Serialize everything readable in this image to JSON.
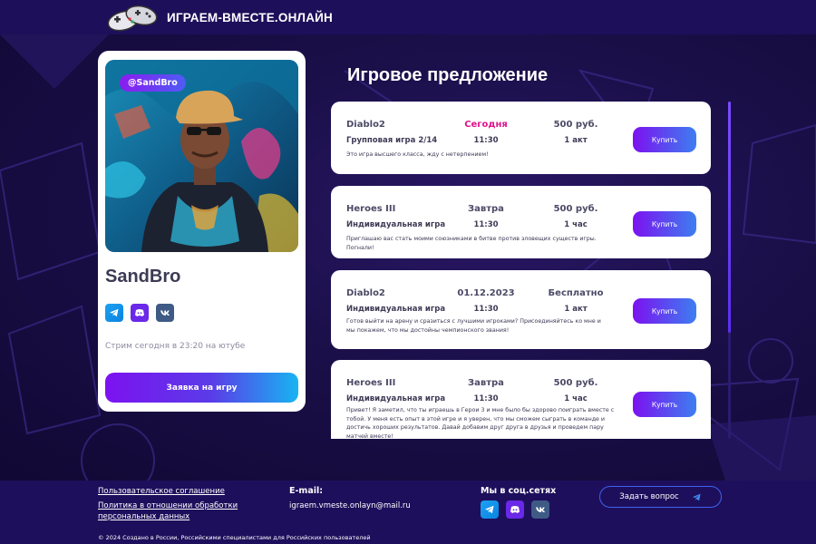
{
  "site": {
    "title": "ИГРАЕМ-ВМЕСТЕ.ОНЛАЙН",
    "logo_icon": "gamepads-icon"
  },
  "profile": {
    "handle": "@SandBro",
    "name": "SandBro",
    "socials": [
      "telegram-icon",
      "discord-icon",
      "vk-icon"
    ],
    "stream_text": "Стрим сегодня в 23:20 на ютубе",
    "apply_label": "Заявка на игру"
  },
  "offers_title": "Игровое предложение",
  "offers": [
    {
      "game": "Diablo2",
      "date": "Сегодня",
      "price": "500 руб.",
      "type": "Групповая игра 2/14",
      "time": "11:30",
      "duration": "1 акт",
      "desc": "Это игра высшего класса, жду с нетерпением!",
      "buy_label": "Купить"
    },
    {
      "game": "Heroes III",
      "date": "Завтра",
      "price": "500 руб.",
      "type": "Индивидуальная игра",
      "time": "11:30",
      "duration": "1 час",
      "desc": "Приглашаю вас стать моими союзниками в битве против зловещих существ игры. Погнали!",
      "buy_label": "Купить"
    },
    {
      "game": "Diablo2",
      "date": "01.12.2023",
      "price": "Бесплатно",
      "type": "Индивидуальная игра",
      "time": "11:30",
      "duration": "1 акт",
      "desc": "Готов выйти на арену и сразиться с лучшими игроками? Присоединяйтесь ко мне и мы покажем, что мы достойны чемпионского звания!",
      "buy_label": "Купить"
    },
    {
      "game": "Heroes III",
      "date": "Завтра",
      "price": "500 руб.",
      "type": "Индивидуальная игра",
      "time": "11:30",
      "duration": "1 час",
      "desc": "Привет! Я заметил, что ты играешь в Герои 3 и мне было бы здорово поиграть вместе с тобой. У меня есть опыт в этой игре и я уверен, что мы сможем сыграть в команде и достичь хороших результатов. Давай добавим друг друга в друзья и проведем пару матчей вместе!",
      "buy_label": "Купить"
    }
  ],
  "footer": {
    "link_agreement": "Пользовательское соглашение",
    "link_privacy_1": "Политика в отношении обработки",
    "link_privacy_2": "персональных данных",
    "email_heading": "E-mail:",
    "email": "igraem.vmeste.onlayn@mail.ru",
    "social_heading": "Мы в соц.сетях",
    "ask_label": "Задать вопрос",
    "copyright": "© 2024 Создано в России, Российскими специалистами для Российских пользователей"
  },
  "colors": {
    "accent_purple": "#7c12f0",
    "accent_blue": "#18b4f2",
    "today_pink": "#e0148c",
    "bg_dark": "#150c3a"
  }
}
